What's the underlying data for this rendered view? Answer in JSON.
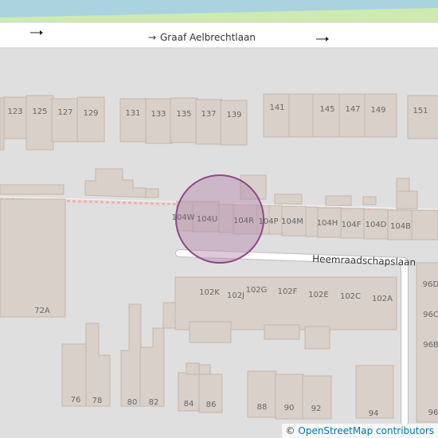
{
  "map": {
    "streets": {
      "graaf": "Graaf Aelbrechtlaan",
      "graaf_arrow": "→",
      "heemraadschapslaan": "Heemraadschapslaan"
    },
    "house_numbers": {
      "n123": "123",
      "n125": "125",
      "n127": "127",
      "n129": "129",
      "n131": "131",
      "n133": "133",
      "n135": "135",
      "n137": "137",
      "n139": "139",
      "n141": "141",
      "n145": "145",
      "n147": "147",
      "n149": "149",
      "n151": "151",
      "n104W": "104W",
      "n104U": "104U",
      "n104R": "104R",
      "n104P": "104P",
      "n104M": "104M",
      "n104H": "104H",
      "n104F": "104F",
      "n104D": "104D",
      "n104B": "104B",
      "n72A": "72A",
      "n102K": "102K",
      "n102J": "102J",
      "n102G": "102G",
      "n102F": "102F",
      "n102E": "102E",
      "n102C": "102C",
      "n102A": "102A",
      "n96D": "96D",
      "n96C": "96C",
      "n96B": "96B",
      "n96": "96",
      "n76": "76",
      "n78": "78",
      "n80": "80",
      "n82": "82",
      "n84": "84",
      "n86": "86",
      "n88": "88",
      "n90": "90",
      "n92": "92",
      "n94": "94"
    },
    "colors": {
      "background": "#e0dfdf",
      "water": "#aad3df",
      "grass": "#cdebb0",
      "building": "#d9d0c9",
      "building_outline": "#c4b6ab",
      "road": "#ffffff",
      "highlight_fill": "#b487ad",
      "highlight_stroke": "#8e4a83"
    }
  },
  "attribution": {
    "symbol": "©",
    "text": "OpenStreetMap contributors"
  }
}
